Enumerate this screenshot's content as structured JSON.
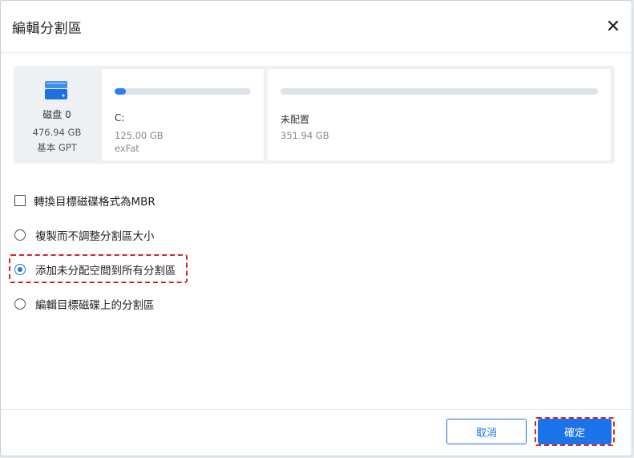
{
  "dialog": {
    "title": "編輯分割區"
  },
  "disk": {
    "name": "磁盘 0",
    "size": "476.94 GB",
    "type": "基本 GPT",
    "icon": "disk-icon"
  },
  "partitions": [
    {
      "label": "C:",
      "size": "125.00 GB",
      "fs": "exFat",
      "used_fraction": 0.08
    },
    {
      "label": "未配置",
      "size": "351.94 GB",
      "used_fraction": 0
    }
  ],
  "options": {
    "convert_mbr": {
      "label": "轉換目標磁碟格式為MBR",
      "checked": false
    },
    "copy_no_resize": {
      "label": "複製而不調整分割區大小",
      "selected": false
    },
    "add_unallocated": {
      "label": "添加未分配空間到所有分割區",
      "selected": true
    },
    "edit_target": {
      "label": "編輯目標磁碟上的分割區",
      "selected": false
    }
  },
  "buttons": {
    "cancel": "取消",
    "ok": "確定"
  },
  "colors": {
    "accent": "#1a73e8",
    "highlight": "#d92525"
  }
}
